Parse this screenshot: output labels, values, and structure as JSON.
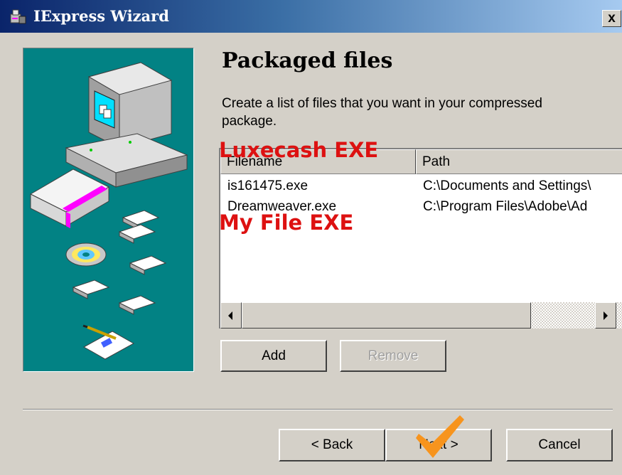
{
  "window": {
    "title": "IExpress Wizard",
    "close_glyph": "x",
    "icon": "iexpress-app-icon"
  },
  "page": {
    "title": "Packaged files",
    "description": "Create a list of files that you want in your compressed package."
  },
  "annotations": {
    "label_top": "Luxecash EXE",
    "label_bottom": "My File EXE",
    "label_color": "#dd1111",
    "checkmark_color": "#f7941d",
    "checkmark_icon": "orange-checkmark-icon"
  },
  "file_list": {
    "columns": [
      "Filename",
      "Path"
    ],
    "rows": [
      {
        "filename": "is161475.exe",
        "path": "C:\\Documents and Settings\\"
      },
      {
        "filename": "Dreamweaver.exe",
        "path": "C:\\Program Files\\Adobe\\Ad"
      }
    ]
  },
  "buttons": {
    "add": "Add",
    "remove": "Remove",
    "back": "< Back",
    "next": "Next >",
    "cancel": "Cancel"
  },
  "colors": {
    "titlebar_start": "#0a246a",
    "titlebar_end": "#a6caf0",
    "dialog_bg": "#d4d0c8",
    "side_panel": "#028284"
  }
}
